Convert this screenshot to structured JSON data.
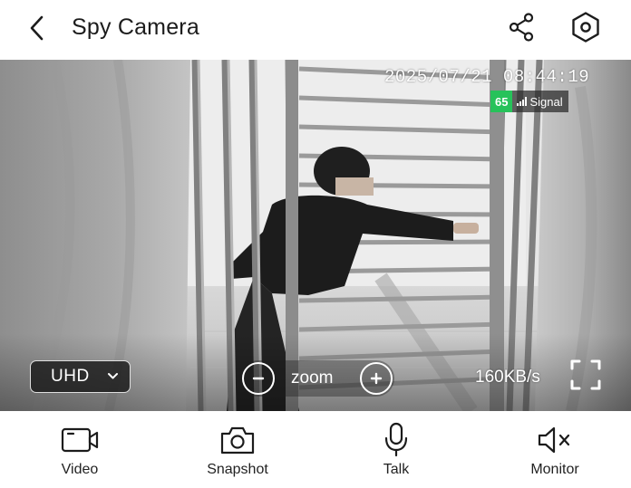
{
  "header": {
    "title": "Spy Camera",
    "back_icon": "chevron-left-icon",
    "share_icon": "share-icon",
    "settings_icon": "hexagon-settings-icon"
  },
  "video": {
    "timestamp": "2025/07/21 08:44:19",
    "signal_value": "65",
    "signal_label": "Signal",
    "quality": "UHD",
    "zoom_label": "zoom",
    "bitrate": "160KB/s",
    "fullscreen_icon": "fullscreen-icon"
  },
  "colors": {
    "signal_green": "#27c25a",
    "icon_dark": "#1c1c1c"
  },
  "toolbar": {
    "items": [
      {
        "label": "Video",
        "icon": "video-camera-icon"
      },
      {
        "label": "Snapshot",
        "icon": "camera-icon"
      },
      {
        "label": "Talk",
        "icon": "microphone-icon"
      },
      {
        "label": "Monitor",
        "icon": "speaker-muted-icon"
      }
    ]
  }
}
